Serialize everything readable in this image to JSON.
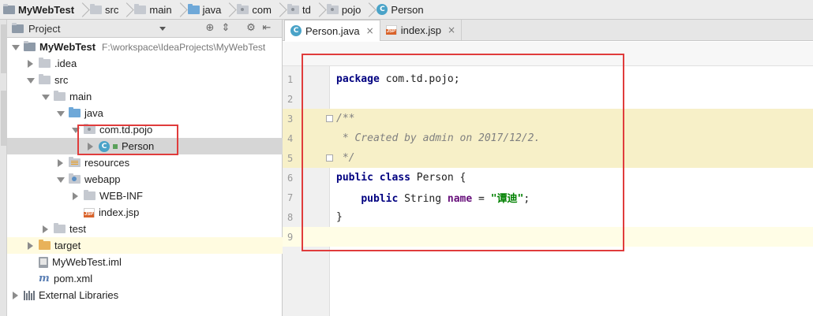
{
  "breadcrumb": [
    {
      "label": "MyWebTest",
      "icon": "project-folder-icon",
      "bold": true
    },
    {
      "label": "src",
      "icon": "folder-icon"
    },
    {
      "label": "main",
      "icon": "folder-icon"
    },
    {
      "label": "java",
      "icon": "source-folder-icon"
    },
    {
      "label": "com",
      "icon": "package-icon"
    },
    {
      "label": "td",
      "icon": "package-icon"
    },
    {
      "label": "pojo",
      "icon": "package-icon"
    },
    {
      "label": "Person",
      "icon": "class-icon"
    }
  ],
  "project_panel": {
    "title": "Project",
    "header_icons": [
      "target-icon",
      "collapse-icon",
      "gear-icon",
      "hide-icon"
    ]
  },
  "tree": [
    {
      "label": "MyWebTest",
      "path": "F:\\workspace\\IdeaProjects\\MyWebTest",
      "depth": 0,
      "arrow": "down",
      "icon": "project"
    },
    {
      "label": ".idea",
      "depth": 1,
      "arrow": "right",
      "icon": "folder"
    },
    {
      "label": "src",
      "depth": 1,
      "arrow": "down",
      "icon": "folder"
    },
    {
      "label": "main",
      "depth": 2,
      "arrow": "down",
      "icon": "folder"
    },
    {
      "label": "java",
      "depth": 3,
      "arrow": "down",
      "icon": "source"
    },
    {
      "label": "com.td.pojo",
      "depth": 4,
      "arrow": "down",
      "icon": "package"
    },
    {
      "label": "Person",
      "depth": 5,
      "arrow": "right",
      "icon": "class",
      "selected": true
    },
    {
      "label": "resources",
      "depth": 3,
      "arrow": "right",
      "icon": "resources"
    },
    {
      "label": "webapp",
      "depth": 3,
      "arrow": "down",
      "icon": "webapp"
    },
    {
      "label": "WEB-INF",
      "depth": 4,
      "arrow": "right",
      "icon": "folder"
    },
    {
      "label": "index.jsp",
      "depth": 4,
      "arrow": "none",
      "icon": "jsp"
    },
    {
      "label": "test",
      "depth": 2,
      "arrow": "right",
      "icon": "folder"
    },
    {
      "label": "target",
      "depth": 1,
      "arrow": "right",
      "icon": "excluded",
      "highlight": true
    },
    {
      "label": "MyWebTest.iml",
      "depth": 1,
      "arrow": "none",
      "icon": "iml"
    },
    {
      "label": "pom.xml",
      "depth": 1,
      "arrow": "none",
      "icon": "maven"
    },
    {
      "label": "External Libraries",
      "depth": 0,
      "arrow": "right",
      "icon": "libraries"
    }
  ],
  "tabs": [
    {
      "label": "Person.java",
      "icon": "class",
      "active": true
    },
    {
      "label": "index.jsp",
      "icon": "jsp",
      "active": false
    }
  ],
  "code_lines": [
    {
      "n": "1",
      "parts": [
        {
          "t": "package",
          "c": "kw"
        },
        {
          "t": " com.td.pojo;",
          "c": ""
        }
      ]
    },
    {
      "n": "2",
      "parts": []
    },
    {
      "n": "3",
      "parts": [
        {
          "t": "/**",
          "c": "cmt"
        }
      ],
      "doc": true,
      "fold": true
    },
    {
      "n": "4",
      "parts": [
        {
          "t": " * Created by admin on 2017/12/2.",
          "c": "cmt"
        }
      ],
      "doc": true
    },
    {
      "n": "5",
      "parts": [
        {
          "t": " */",
          "c": "cmt"
        }
      ],
      "doc": true,
      "fold": true
    },
    {
      "n": "6",
      "parts": [
        {
          "t": "public class",
          "c": "kw"
        },
        {
          "t": " Person {",
          "c": ""
        }
      ]
    },
    {
      "n": "7",
      "parts": [
        {
          "t": "    ",
          "c": ""
        },
        {
          "t": "public",
          "c": "kw"
        },
        {
          "t": " String ",
          "c": ""
        },
        {
          "t": "name",
          "c": "fld"
        },
        {
          "t": " = ",
          "c": ""
        },
        {
          "t": "\"谭迪\"",
          "c": "str"
        },
        {
          "t": ";",
          "c": ""
        }
      ]
    },
    {
      "n": "8",
      "parts": [
        {
          "t": "}",
          "c": ""
        }
      ]
    },
    {
      "n": "9",
      "parts": [],
      "current": true
    }
  ],
  "colors": {
    "highlight_box": "#e03c3c",
    "keyword": "#000080",
    "string": "#008000",
    "field": "#660e7a",
    "comment": "#808080"
  }
}
